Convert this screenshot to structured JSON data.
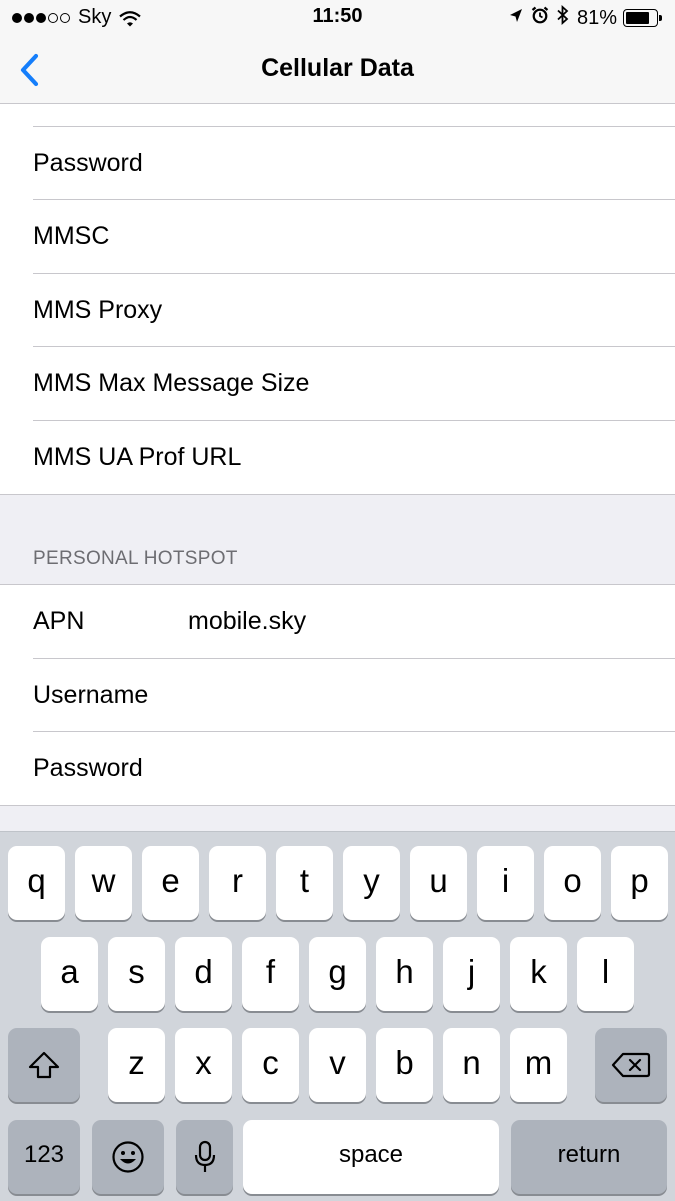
{
  "status_bar": {
    "carrier": "Sky",
    "time": "11:50",
    "battery": "81%",
    "battery_level": 0.81,
    "signal_bars_filled": 3,
    "signal_bars_total": 5
  },
  "nav": {
    "title": "Cellular Data",
    "back_icon": "chevron-left-icon",
    "accent_color": "#157efb"
  },
  "mms_section": {
    "rows": [
      {
        "label": "Password"
      },
      {
        "label": "MMSC"
      },
      {
        "label": "MMS Proxy"
      },
      {
        "label": "MMS Max Message Size"
      },
      {
        "label": "MMS UA Prof URL"
      }
    ]
  },
  "hotspot_section": {
    "header": "PERSONAL HOTSPOT",
    "rows": [
      {
        "label": "APN",
        "value": "mobile.sky"
      },
      {
        "label": "Username",
        "value": ""
      },
      {
        "label": "Password",
        "value": ""
      }
    ]
  },
  "keyboard": {
    "row1": [
      "q",
      "w",
      "e",
      "r",
      "t",
      "y",
      "u",
      "i",
      "o",
      "p"
    ],
    "row2": [
      "a",
      "s",
      "d",
      "f",
      "g",
      "h",
      "j",
      "k",
      "l"
    ],
    "row3": [
      "z",
      "x",
      "c",
      "v",
      "b",
      "n",
      "m"
    ],
    "numbers_label": "123",
    "space_label": "space",
    "return_label": "return",
    "shift_icon": "shift-icon",
    "delete_icon": "delete-icon",
    "emoji_icon": "emoji-icon",
    "mic_icon": "microphone-icon"
  }
}
